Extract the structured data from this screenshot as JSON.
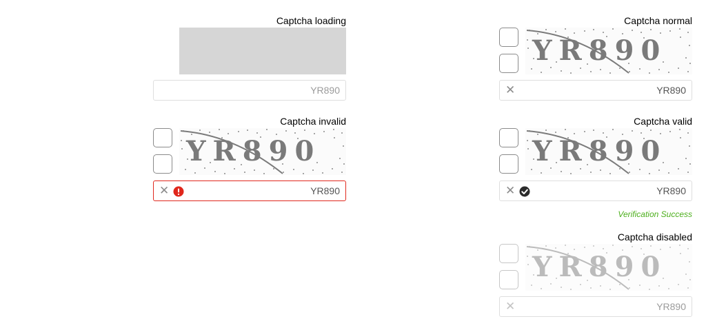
{
  "captchas": {
    "loading": {
      "title": "Captcha loading",
      "value": "YR890"
    },
    "normal": {
      "title": "Captcha normal",
      "value": "YR890"
    },
    "invalid": {
      "title": "Captcha invalid",
      "value": "YR890"
    },
    "valid": {
      "title": "Captcha valid",
      "value": "YR890",
      "message": "Verification Success"
    },
    "disabled": {
      "title": "Captcha disabled",
      "value": "YR890"
    }
  },
  "captcha_image_text": "YR890",
  "icons": {
    "clear": "close-icon",
    "error": "error-circle-icon",
    "success": "check-circle-icon"
  },
  "colors": {
    "error": "#e0271c",
    "success": "#4caf1c",
    "loading_bg": "#d6d6d6"
  }
}
